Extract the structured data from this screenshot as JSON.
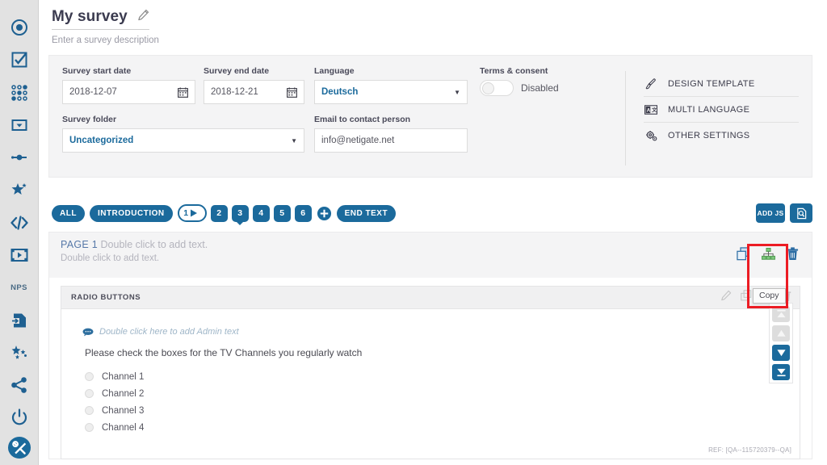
{
  "sidebar": {
    "items": [
      {
        "name": "radio-button-icon",
        "icon": "radio-target"
      },
      {
        "name": "checkbox-icon",
        "icon": "checkbox"
      },
      {
        "name": "matrix-grid-icon",
        "icon": "dot-grid"
      },
      {
        "name": "dropdown-icon",
        "icon": "dropdown"
      },
      {
        "name": "slider-icon",
        "icon": "slider"
      },
      {
        "name": "rating-star-icon",
        "icon": "star"
      },
      {
        "name": "html-code-icon",
        "icon": "code"
      },
      {
        "name": "media-video-icon",
        "icon": "film"
      },
      {
        "name": "nps-icon",
        "icon": "nps",
        "label": "NPS"
      },
      {
        "name": "import-question-icon",
        "icon": "import-doc"
      },
      {
        "name": "smart-questions-icon",
        "icon": "sparkle-stars"
      },
      {
        "name": "share-icon",
        "icon": "share"
      },
      {
        "name": "power-icon",
        "icon": "power"
      },
      {
        "name": "tools-icon",
        "icon": "tools",
        "active": true
      }
    ]
  },
  "header": {
    "title": "My survey",
    "edit_icon": "pencil-icon",
    "description_placeholder": "Enter a survey description"
  },
  "settings": {
    "start_date": {
      "label": "Survey start date",
      "value": "2018-12-07",
      "icon": "calendar-icon"
    },
    "end_date": {
      "label": "Survey end date",
      "value": "2018-12-21",
      "icon": "calendar-icon"
    },
    "language": {
      "label": "Language",
      "value": "Deutsch",
      "icon": "chevron-down-icon"
    },
    "terms": {
      "label": "Terms & consent",
      "state_label": "Disabled",
      "enabled": false
    },
    "folder": {
      "label": "Survey folder",
      "value": "Uncategorized",
      "icon": "chevron-down-icon"
    },
    "email": {
      "label": "Email to contact person",
      "value": "info@netigate.net"
    },
    "links": [
      {
        "label": "DESIGN TEMPLATE",
        "icon": "brush-icon"
      },
      {
        "label": "MULTI LANGUAGE",
        "icon": "translate-icon"
      },
      {
        "label": "OTHER SETTINGS",
        "icon": "gears-icon"
      }
    ]
  },
  "tabs": {
    "all": "ALL",
    "introduction": "INTRODUCTION",
    "pages": [
      {
        "label": "1",
        "active": true
      },
      {
        "label": "2",
        "active": false
      },
      {
        "label": "3",
        "active": false,
        "marked": true
      },
      {
        "label": "4",
        "active": false
      },
      {
        "label": "5",
        "active": false
      },
      {
        "label": "6",
        "active": false
      }
    ],
    "add_page_icon": "plus-circle-icon",
    "end_text": "END TEXT",
    "add_js": "ADD JS",
    "preview_icon": "preview-document-icon"
  },
  "page_header": {
    "page_label": "PAGE 1",
    "heading_placeholder": "Double click to add text.",
    "subtext_placeholder": "Double click to add text.",
    "tools": [
      {
        "name": "copy-page-icon",
        "label": "Copy"
      },
      {
        "name": "logic-page-icon",
        "label": "Logic"
      },
      {
        "name": "delete-page-icon",
        "label": "Delete"
      }
    ]
  },
  "tooltip": {
    "text": "Copy"
  },
  "question": {
    "type_label": "RADIO BUTTONS",
    "header_icons": [
      "edit-question-icon",
      "copy-question-icon",
      "logic-question-icon",
      "delete-question-icon"
    ],
    "admin_text_placeholder": "Double click here to add Admin text",
    "admin_icon": "comment-icon",
    "text": "Please check the boxes for the TV Channels you regularly watch",
    "options": [
      "Channel 1",
      "Channel 2",
      "Channel 3",
      "Channel 4"
    ],
    "ref": "REF: [QA--115720379--QA]"
  },
  "move_buttons": [
    {
      "name": "move-to-top-button",
      "icon": "double-up",
      "enabled": false
    },
    {
      "name": "move-up-button",
      "icon": "up",
      "enabled": false
    },
    {
      "name": "move-down-button",
      "icon": "down",
      "enabled": true
    },
    {
      "name": "move-to-bottom-button",
      "icon": "double-down",
      "enabled": true
    }
  ],
  "colors": {
    "brand_blue": "#1b6a9c",
    "highlight_red": "#ec1c24",
    "panel_gray": "#f4f4f5",
    "rail_gray": "#e2e2e2"
  }
}
